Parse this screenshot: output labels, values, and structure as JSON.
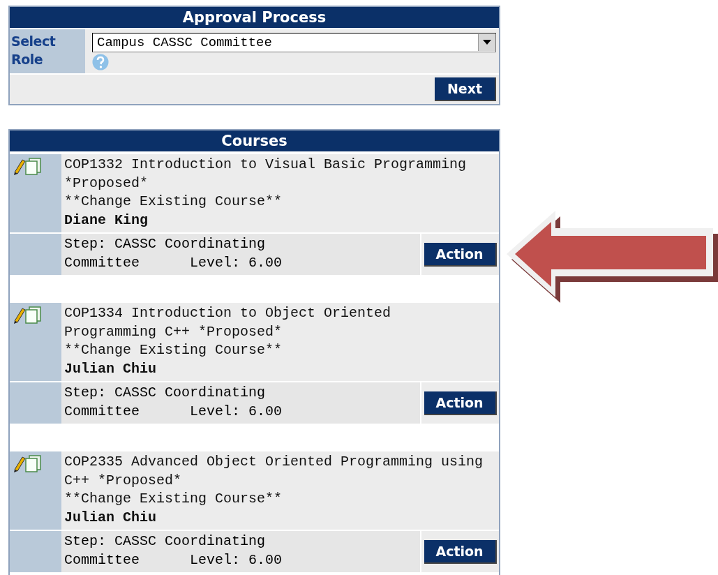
{
  "approval": {
    "title": "Approval Process",
    "role_label": "Select Role",
    "role_value": "Campus CASSC Committee",
    "next_button": "Next"
  },
  "courses": {
    "title": "Courses",
    "items": [
      {
        "title": "COP1332 Introduction to Visual Basic Programming\n*Proposed*",
        "change": "**Change Existing Course**",
        "author": "Diane King",
        "step": "Step: CASSC Coordinating\nCommittee      Level: 6.00",
        "action": "Action"
      },
      {
        "title": "COP1334 Introduction to Object Oriented\nProgramming C++ *Proposed*",
        "change": "**Change Existing Course**",
        "author": "Julian Chiu",
        "step": "Step: CASSC Coordinating\nCommittee      Level: 6.00",
        "action": "Action"
      },
      {
        "title": "COP2335 Advanced Object Oriented Programming using\nC++ *Proposed*",
        "change": "**Change Existing Course**",
        "author": "Julian Chiu",
        "step": "Step: CASSC Coordinating\nCommittee      Level: 6.00",
        "action": "Action"
      }
    ]
  }
}
